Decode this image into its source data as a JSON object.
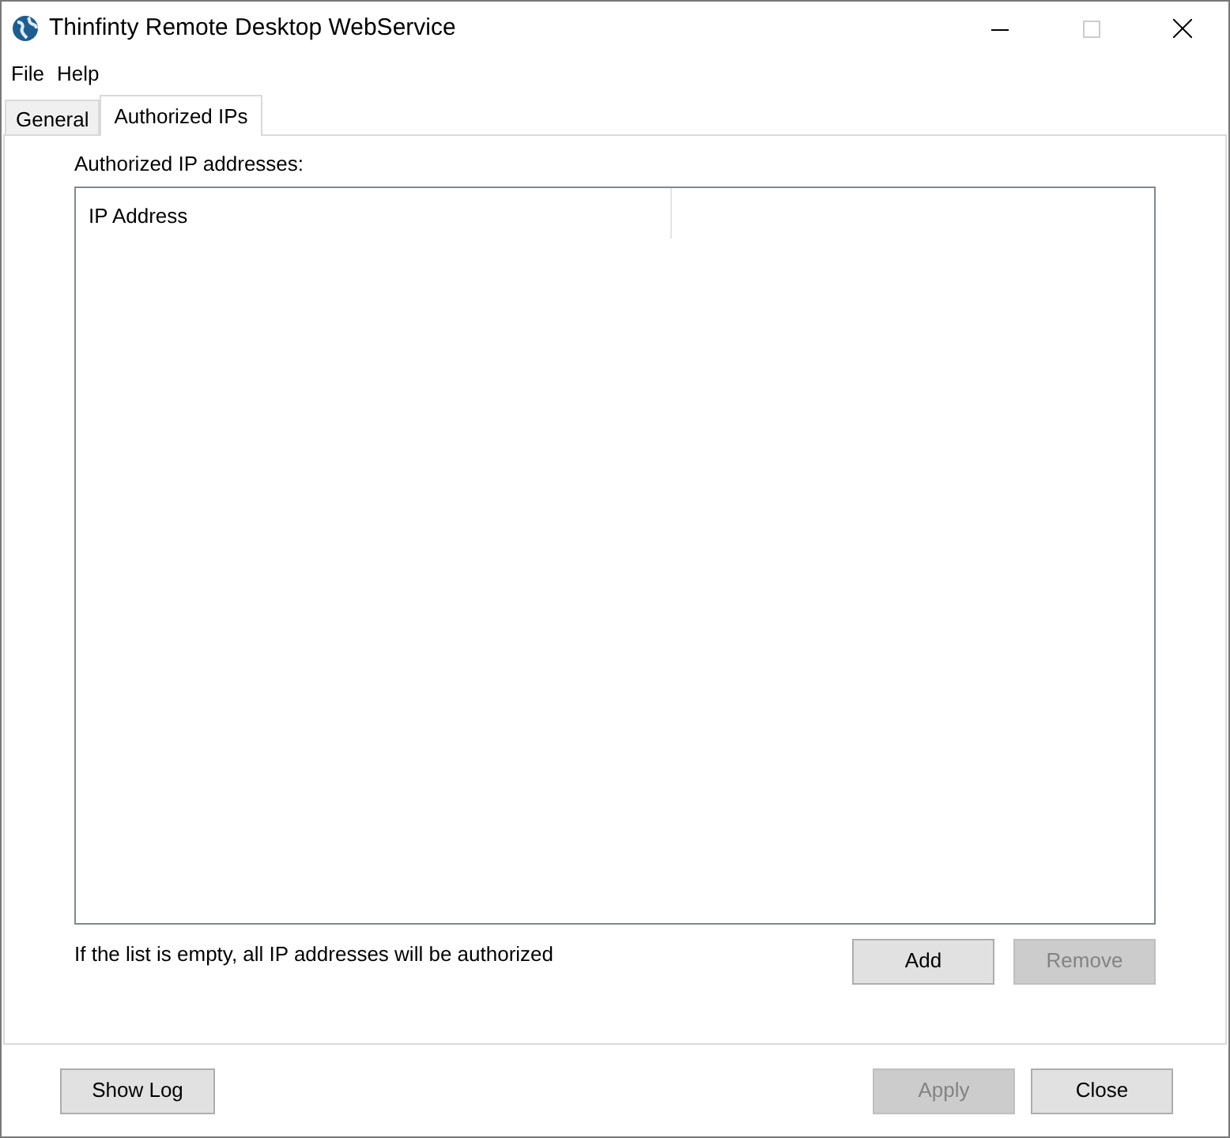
{
  "window": {
    "title": "Thinfinty Remote Desktop WebService"
  },
  "menu": [
    "File",
    "Help"
  ],
  "tabs": [
    {
      "label": "General",
      "selected": false
    },
    {
      "label": "Authorized IPs",
      "selected": true
    }
  ],
  "list_label": "Authorized IP addresses:",
  "list": {
    "columns": [
      "IP Address"
    ]
  },
  "hint": "If the list is empty, all IP addresses will be authorized",
  "list_buttons": [
    {
      "label": "Add",
      "disabled": false
    },
    {
      "label": "Remove",
      "disabled": true
    }
  ],
  "footer_left": {
    "label": "Show Log",
    "disabled": false
  },
  "footer_buttons": [
    {
      "label": "Apply",
      "disabled": true
    },
    {
      "label": "Close",
      "disabled": false
    }
  ]
}
